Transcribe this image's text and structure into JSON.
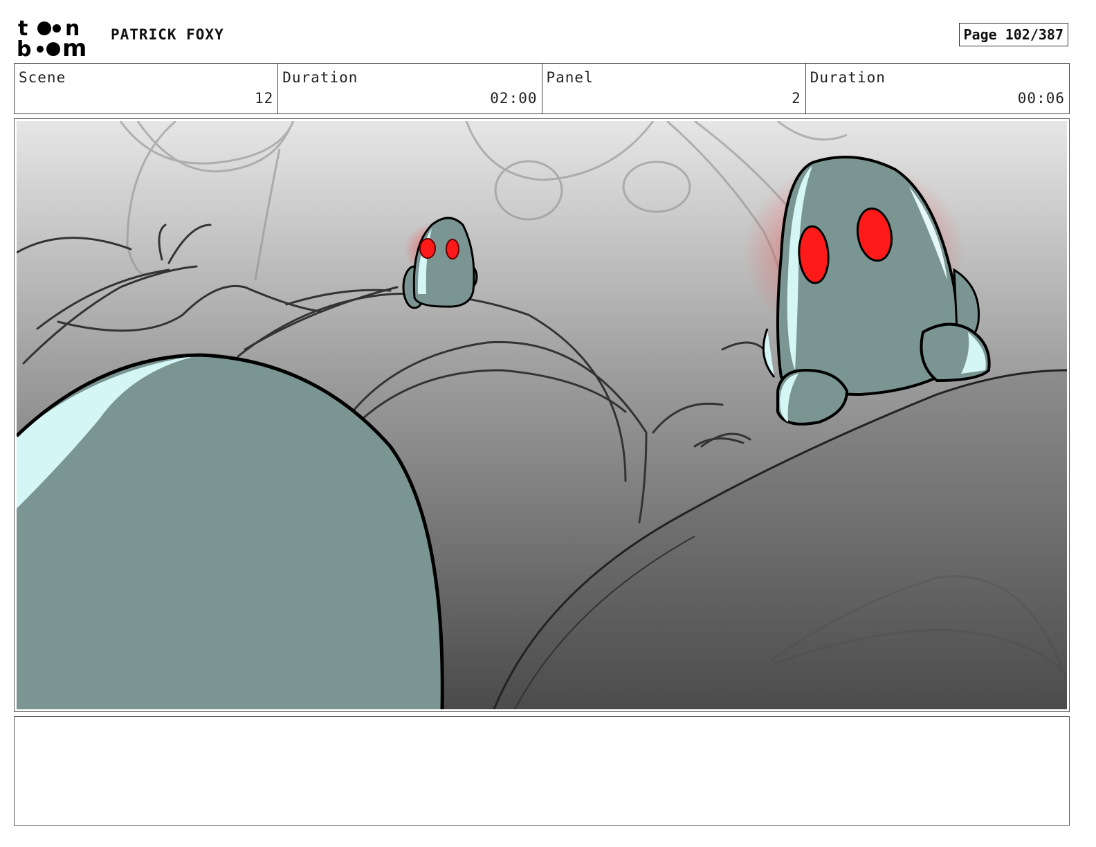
{
  "header": {
    "logo_top": "t",
    "logo_bottom": "b",
    "logo_top_end": "n",
    "logo_bottom_end": "m",
    "title": "PATRICK FOXY",
    "page": "Page 102/387"
  },
  "info": {
    "scene_label": "Scene",
    "scene_value": "12",
    "scene_duration_label": "Duration",
    "scene_duration_value": "02:00",
    "panel_label": "Panel",
    "panel_value": "2",
    "panel_duration_label": "Duration",
    "panel_duration_value": "00:06"
  },
  "colors": {
    "creature_body": "#7a9592",
    "creature_highlight": "#d4f7f6",
    "eye": "#ff1a1a",
    "ground": "#555555",
    "sky": "#e6e6e6"
  },
  "notes": {
    "text": ""
  }
}
